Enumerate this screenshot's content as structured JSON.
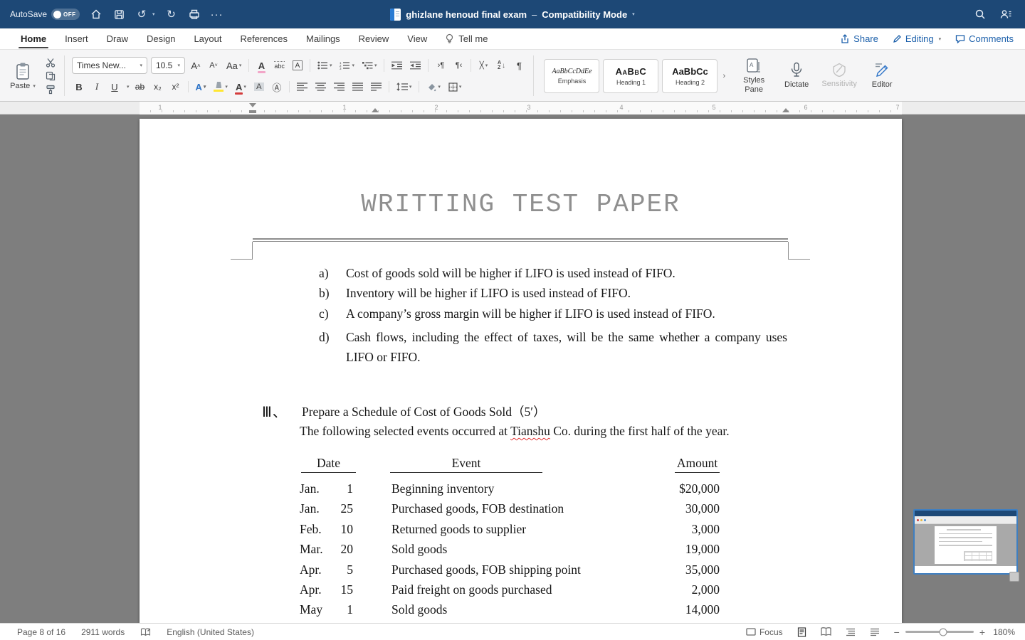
{
  "titlebar": {
    "autosave_label": "AutoSave",
    "autosave_state": "OFF",
    "doc_title": "ghizlane henoud final exam",
    "separator": "–",
    "doc_mode": "Compatibility Mode"
  },
  "menubar": {
    "tabs": [
      "Home",
      "Insert",
      "Draw",
      "Design",
      "Layout",
      "References",
      "Mailings",
      "Review",
      "View"
    ],
    "tell_me": "Tell me",
    "actions": {
      "share": "Share",
      "editing": "Editing",
      "comments": "Comments"
    }
  },
  "ribbon": {
    "paste_label": "Paste",
    "font_name": "Times New...",
    "font_size": "10.5",
    "grow_font": "A",
    "shrink_font": "A",
    "change_case": "Aa",
    "clear_format": "A",
    "char_border": "A",
    "bold": "B",
    "italic": "I",
    "underline": "U",
    "strikethrough": "ab",
    "subscript": "x₂",
    "superscript": "x²",
    "text_effects": "A",
    "font_color": "A",
    "char_shading": "A",
    "enclose_char": "Ⓐ",
    "ltr_mark": "›¶",
    "rtl_mark": "¶‹",
    "pilcrow": "¶",
    "sort_a": "A",
    "sort_z": "Z",
    "styles_gallery": [
      {
        "sample": "AaBbCcDdEe",
        "name": "Emphasis"
      },
      {
        "sample": "AaBbC",
        "name": "Heading 1"
      },
      {
        "sample": "AaBbCc",
        "name": "Heading 2"
      }
    ],
    "styles_pane": "Styles Pane",
    "dictate": "Dictate",
    "sensitivity": "Sensitivity",
    "editor": "Editor"
  },
  "ruler": {
    "numbers": [
      "1",
      "1",
      "2",
      "3",
      "4",
      "5",
      "6",
      "7"
    ]
  },
  "document": {
    "title": "WRITTING TEST PAPER",
    "choices": [
      {
        "marker": "a)",
        "text": "Cost of goods sold will be higher if LIFO is used instead of FIFO."
      },
      {
        "marker": "b)",
        "text": "Inventory will be higher if LIFO is used instead of FIFO."
      },
      {
        "marker": "c)",
        "text": "A company’s gross margin will be higher if LIFO is used instead of FIFO."
      },
      {
        "marker": "d)",
        "text": "Cash flows, including the effect of taxes, will be the same whether a company uses LIFO or FIFO."
      }
    ],
    "section": {
      "number": "Ⅲ、",
      "heading": "Prepare a Schedule of Cost of Goods Sold（5′）",
      "intro_before": "The following selected events occurred at ",
      "company": "Tianshu",
      "intro_after": " Co. during the first half of the year."
    },
    "table": {
      "headers": {
        "date": "Date",
        "event": "Event",
        "amount": "Amount"
      },
      "rows": [
        {
          "month": "Jan.",
          "day": "1",
          "event": "Beginning inventory",
          "amount": "$20,000"
        },
        {
          "month": "Jan.",
          "day": "25",
          "event": "Purchased goods, FOB destination",
          "amount": "30,000"
        },
        {
          "month": "Feb.",
          "day": "10",
          "event": "Returned goods to supplier",
          "amount": "3,000"
        },
        {
          "month": "Mar.",
          "day": "20",
          "event": "Sold goods",
          "amount": "19,000"
        },
        {
          "month": "Apr.",
          "day": "5",
          "event": "Purchased goods, FOB shipping point",
          "amount": "35,000"
        },
        {
          "month": "Apr.",
          "day": "15",
          "event": "Paid freight on goods purchased",
          "amount": "2,000"
        },
        {
          "month": "May",
          "day": "1",
          "event": "Sold goods",
          "amount": "14,000"
        }
      ]
    }
  },
  "statusbar": {
    "page": "Page 8 of 16",
    "words": "2911 words",
    "language": "English (United States)",
    "focus": "Focus",
    "zoom": "180%"
  }
}
